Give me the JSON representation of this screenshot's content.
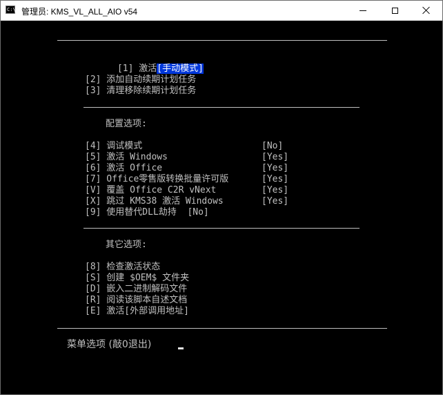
{
  "window": {
    "title": "管理员:  KMS_VL_ALL_AIO v54",
    "icon_label": "C:\\",
    "controls": [
      "minimize-icon",
      "maximize-icon",
      "close-icon"
    ]
  },
  "menu": {
    "activate_prefix": "[1] 激活",
    "activate_mode": "[手动模式]",
    "add_renewal": "[2] 添加自动续期计划任务",
    "clear_renewal": "[3] 清理移除续期计划任务"
  },
  "config": {
    "heading": "配置选项:",
    "items": [
      {
        "label": "[4] 调试模式",
        "value": "[No]"
      },
      {
        "label": "[5] 激活 Windows",
        "value": "[Yes]"
      },
      {
        "label": "[6] 激活 Office",
        "value": "[Yes]"
      },
      {
        "label": "[7] Office零售版转换批量许可版",
        "value": "[Yes]"
      },
      {
        "label": "[V] 覆盖 Office C2R vNext",
        "value": "[Yes]"
      },
      {
        "label": "[X] 跳过 KMS38 激活 Windows",
        "value": "[Yes]"
      }
    ],
    "alt_dll": "[9] 使用替代DLL劫持  [No]"
  },
  "other": {
    "heading": "其它选项:",
    "items": [
      "[8] 检查激活状态",
      "[S] 创建 $OEM$ 文件夹",
      "[D] 嵌入二进制解码文件",
      "[R] 阅读该脚本自述文档",
      "[E] 激活[外部调用地址]"
    ]
  },
  "prompt": "菜单选项 (敲0退出)"
}
